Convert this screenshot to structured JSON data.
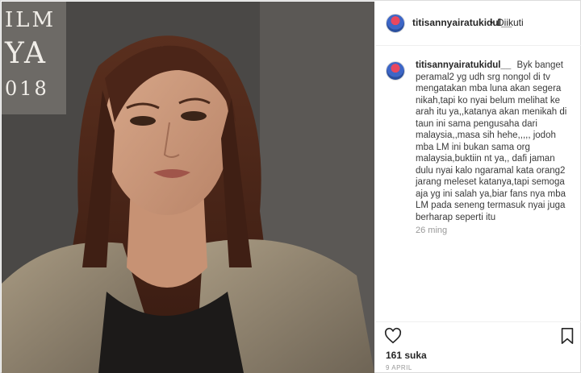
{
  "post": {
    "username": "titisannyairatukidul__",
    "separator": "•",
    "follow_status": "Diikuti",
    "caption_username": "titisannyairatukidul__",
    "caption_text": "Byk banget peramal2 yg udh srg nongol di tv mengatakan mba luna akan segera nikah,tapi ko nyai belum melihat ke arah itu ya,,katanya akan menikah di taun ini sama pengusaha dari malaysia,,masa sih hehe,,,,, jodoh mba LM ini bukan sama org malaysia,buktiin nt ya,, dafi jaman dulu nyai kalo ngaramal kata orang2 jarang meleset katanya,tapi semoga aja yg ini salah ya,biar fans nya mba LM pada seneng termasuk nyai juga berharap seperti itu",
    "time_ago": "26 ming",
    "likes": "161 suka",
    "date": "9 APRIL"
  },
  "photo": {
    "banner_line1": "ILM",
    "banner_line2": "YA",
    "banner_line3": "018"
  },
  "icons": {
    "avatar": "avatar-icon",
    "like": "heart-icon",
    "save": "bookmark-icon"
  },
  "colors": {
    "text": "#262626",
    "muted": "#999999",
    "border": "#dbdbdb"
  }
}
